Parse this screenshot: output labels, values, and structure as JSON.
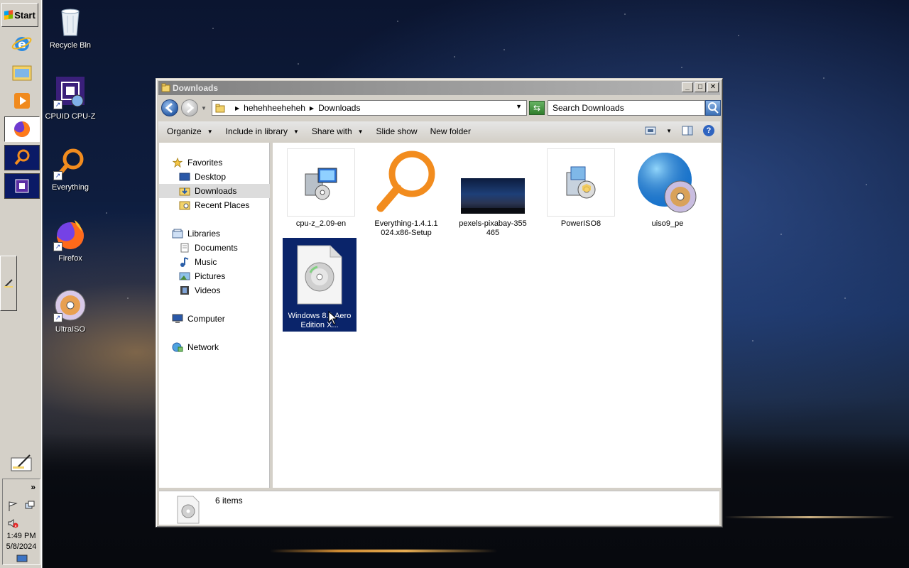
{
  "taskbar": {
    "start_label": "Start",
    "clock_time": "1:49 PM",
    "clock_date": "5/8/2024",
    "quick_launch": [
      {
        "name": "internet-explorer-icon"
      },
      {
        "name": "windows-explorer-icon"
      },
      {
        "name": "media-player-icon"
      },
      {
        "name": "firefox-icon"
      },
      {
        "name": "everything-search-icon"
      },
      {
        "name": "cpu-z-icon"
      }
    ],
    "overflow_label": "»"
  },
  "desktop": {
    "icons": [
      {
        "label": "Recycle Bin"
      },
      {
        "label": "CPUID CPU-Z"
      },
      {
        "label": "Everything"
      },
      {
        "label": "Firefox"
      },
      {
        "label": "UltraISO"
      }
    ]
  },
  "window": {
    "title": "Downloads",
    "breadcrumb": [
      "hehehheeheheh",
      "Downloads"
    ],
    "search_placeholder": "Search Downloads",
    "toolbar": {
      "organize": "Organize",
      "include": "Include in library",
      "share": "Share with",
      "slideshow": "Slide show",
      "newfolder": "New folder",
      "help": "?"
    },
    "nav": {
      "favorites": "Favorites",
      "desktop": "Desktop",
      "downloads": "Downloads",
      "recent": "Recent Places",
      "libraries": "Libraries",
      "documents": "Documents",
      "music": "Music",
      "pictures": "Pictures",
      "videos": "Videos",
      "computer": "Computer",
      "network": "Network"
    },
    "files": [
      {
        "name": "cpu-z_2.09-en",
        "icon": "installer-icon"
      },
      {
        "name": "Everything-1.4.1.1\n024.x86-Setup",
        "icon": "magnifier-icon"
      },
      {
        "name": "pexels-pixabay-355\n465",
        "icon": "image-thumbnail"
      },
      {
        "name": "PowerISO8",
        "icon": "installer-icon"
      },
      {
        "name": "uiso9_pe",
        "icon": "globe-disc-icon"
      },
      {
        "name": "Windows 8.1 Aero\nEdition X...",
        "icon": "disc-image-icon",
        "selected": true
      }
    ],
    "status": "6 items"
  },
  "colors": {
    "selection": "#0a246a",
    "chrome": "#d4d0c8",
    "everything_orange": "#f28c1e"
  }
}
